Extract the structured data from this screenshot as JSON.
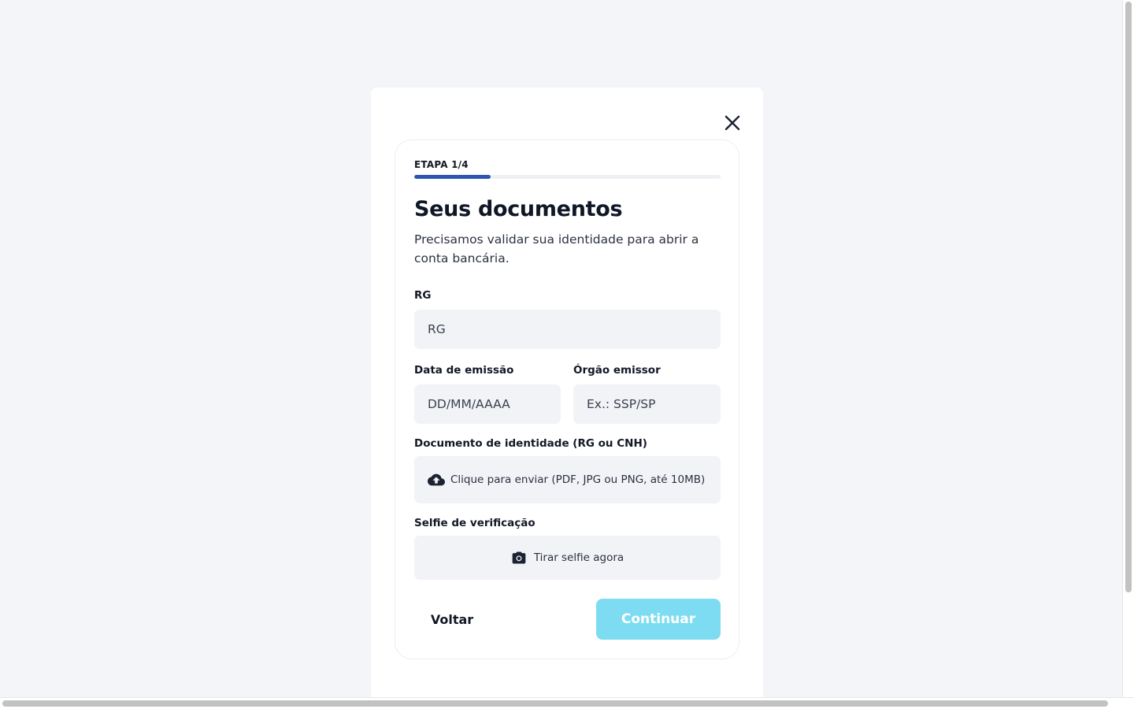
{
  "modal": {
    "close_icon": "close-icon",
    "step": {
      "label": "ETAPA 1/4",
      "current": 1,
      "total": 4,
      "progress_fraction": 0.25,
      "progress_color": "#2d56b3"
    },
    "title": "Seus documentos",
    "subtitle": "Precisamos validar sua identidade para abrir a conta bancária.",
    "fields": {
      "rg": {
        "label": "RG",
        "placeholder": "RG",
        "value": ""
      },
      "issue_date": {
        "label": "Data de emissão",
        "placeholder": "DD/MM/AAAA",
        "value": ""
      },
      "issuer": {
        "label": "Órgão emissor",
        "placeholder": "Ex.: SSP/SP",
        "value": ""
      }
    },
    "document_upload": {
      "label": "Documento de identidade (RG ou CNH)",
      "text": "Clique para enviar (PDF, JPG ou PNG, até 10MB)",
      "icon": "cloud-upload-icon"
    },
    "selfie": {
      "label": "Selfie de verificação",
      "text": "Tirar selfie agora",
      "icon": "camera-icon"
    },
    "actions": {
      "back_label": "Voltar",
      "continue_label": "Continuar",
      "continue_color": "#7edcf2"
    }
  }
}
